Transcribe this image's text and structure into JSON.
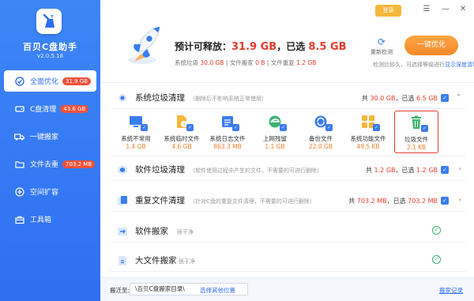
{
  "app": {
    "name": "百贝C盘助手",
    "version": "v2.0.5.18",
    "brand_color": "#2f6ff0",
    "accent_red": "#e43b2d"
  },
  "titlebar": {
    "login": "登录",
    "menu": "☰",
    "minimize": "—",
    "close": "✕"
  },
  "sidebar": {
    "items": [
      {
        "label": "全面优化",
        "badge": "31.9 GB",
        "icon": "broom-icon"
      },
      {
        "label": "C盘清理",
        "badge": "43.6 GB",
        "icon": "disk-icon"
      },
      {
        "label": "一键搬家",
        "badge": "",
        "icon": "truck-icon"
      },
      {
        "label": "文件去重",
        "badge": "703.2 MB",
        "icon": "folder-icon"
      },
      {
        "label": "空间扩容",
        "badge": "",
        "icon": "expand-icon"
      },
      {
        "label": "工具箱",
        "badge": "",
        "icon": "toolbox-icon"
      }
    ]
  },
  "header": {
    "title_prefix": "预计可释放：",
    "title_total": "31.9 GB",
    "title_sep": "，已选",
    "title_selected": "8.5 GB",
    "sub_sys_label": "系统垃圾",
    "sub_sys_value": "30.0 GB",
    "sub_move_label": " | 文件搬家",
    "sub_move_value": "0 B",
    "sub_dup_label": " | 文件重复",
    "sub_dup_value": "1.2 GB",
    "rescan": "重新检测",
    "optimize": "一键优化",
    "hint_text": "检测比较久，可选择等级进行",
    "hint_link": "显示深度清理"
  },
  "sections": [
    {
      "title": "系统垃圾清理",
      "desc": "（删除后不影响系统正常使用）",
      "total_prefix": "共",
      "total": "30.0 GB",
      "sel_prefix": "，已选",
      "selected": "6.5 GB",
      "expanded": true
    },
    {
      "title": "软件垃圾清理",
      "desc": "（软件使用过程中产生的文件，不需要的可进行删除）",
      "total_prefix": "共",
      "total": "1.2 GB",
      "sel_prefix": "，已选",
      "selected": "1.2 GB"
    },
    {
      "title": "重复文件清理",
      "desc": "（针对C盘的重复文件清理，不需要的可进行删除）",
      "total_prefix": "共",
      "total": "703.2 MB",
      "sel_prefix": "，已选",
      "selected": "703.2 MB"
    },
    {
      "title": "软件搬家",
      "desc": "很干净",
      "status": "ok"
    },
    {
      "title": "大文件搬家",
      "desc": "很干净",
      "status": "ok"
    }
  ],
  "junk_items": [
    {
      "name": "系统不常用",
      "size": "1.4 GB",
      "icon": "monitor-icon"
    },
    {
      "name": "系统临时文件",
      "size": "4.6 GB",
      "icon": "temp-file-icon"
    },
    {
      "name": "系统日志文件",
      "size": "863.3 MB",
      "icon": "log-file-icon"
    },
    {
      "name": "上网残留",
      "size": "1.1 GB",
      "icon": "browser-icon"
    },
    {
      "name": "备份文件",
      "size": "22.0 GB",
      "icon": "backup-icon"
    },
    {
      "name": "系统功能文件",
      "size": "49.5 KB",
      "icon": "apps-icon"
    },
    {
      "name": "垃圾文件",
      "size": "2.1 KB",
      "icon": "trash-icon"
    }
  ],
  "footer": {
    "label": "搬迁至:",
    "path": "\\百贝C盘搬家目录\\",
    "change": "选择其他位置",
    "history": "搬家记录"
  }
}
